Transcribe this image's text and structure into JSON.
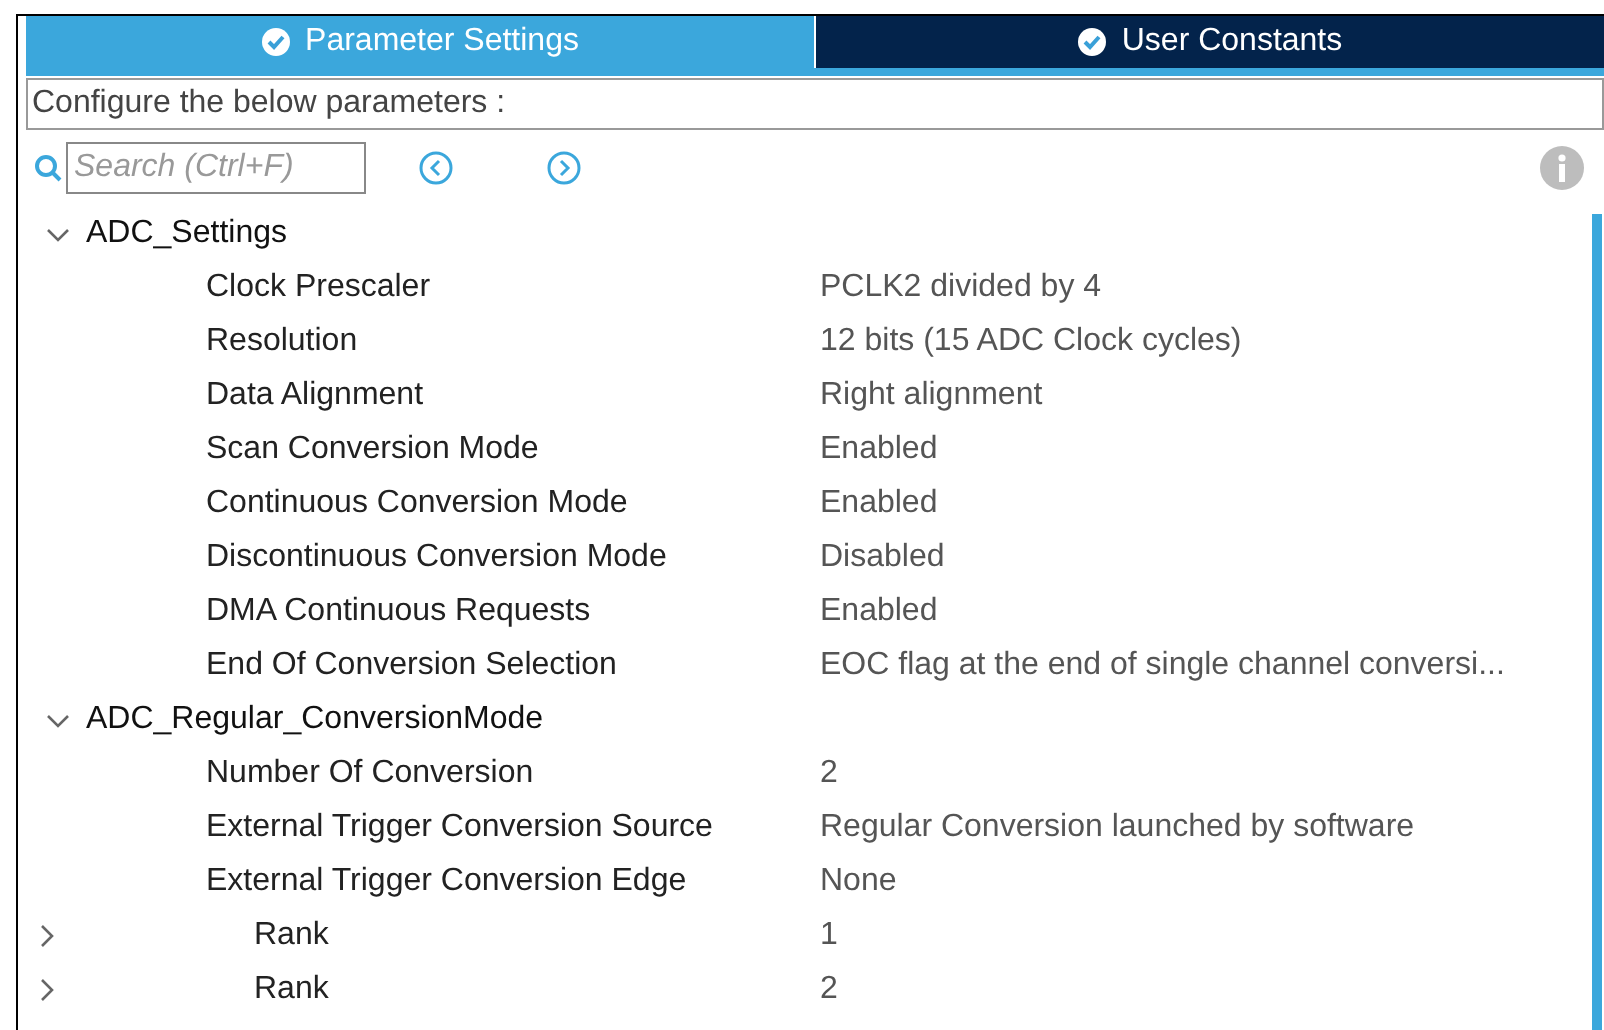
{
  "tabs": [
    {
      "label": "Parameter Settings",
      "selected": true
    },
    {
      "label": "User Constants",
      "selected": false
    }
  ],
  "description": "Configure the below parameters :",
  "search": {
    "placeholder": "Search (Ctrl+F)"
  },
  "groups": [
    {
      "name": "ADC_Settings",
      "expanded": true,
      "children": [
        {
          "label": "Clock Prescaler",
          "value": "PCLK2 divided by 4"
        },
        {
          "label": "Resolution",
          "value": "12 bits (15 ADC Clock cycles)"
        },
        {
          "label": "Data Alignment",
          "value": "Right alignment"
        },
        {
          "label": "Scan Conversion Mode",
          "value": "Enabled"
        },
        {
          "label": "Continuous Conversion Mode",
          "value": "Enabled"
        },
        {
          "label": "Discontinuous Conversion Mode",
          "value": "Disabled"
        },
        {
          "label": "DMA Continuous Requests",
          "value": "Enabled"
        },
        {
          "label": "End Of Conversion Selection",
          "value": "EOC flag at the end of single channel conversi..."
        }
      ]
    },
    {
      "name": "ADC_Regular_ConversionMode",
      "expanded": true,
      "children": [
        {
          "label": "Number Of Conversion",
          "value": "2"
        },
        {
          "label": "External Trigger Conversion Source",
          "value": "Regular Conversion launched by software"
        },
        {
          "label": "External Trigger Conversion Edge",
          "value": "None"
        },
        {
          "label": "Rank",
          "value": "1",
          "expanded": false
        },
        {
          "label": "Rank",
          "value": "2",
          "expanded": false
        }
      ]
    }
  ]
}
